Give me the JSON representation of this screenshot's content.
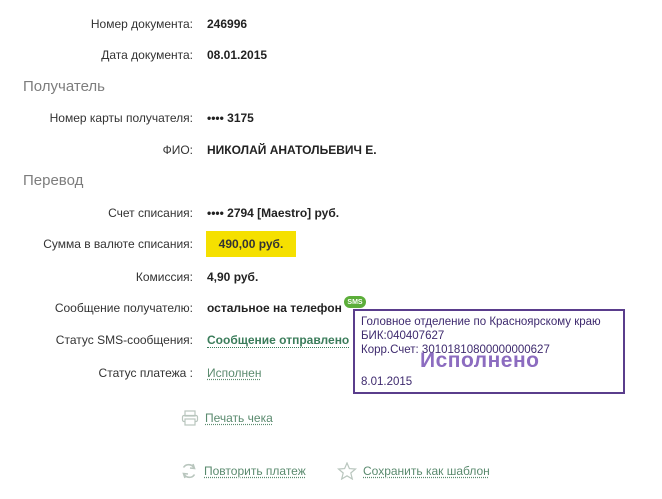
{
  "document": {
    "number_label": "Номер документа:",
    "number_value": "246996",
    "date_label": "Дата документа:",
    "date_value": "08.01.2015"
  },
  "recipient": {
    "section_title": "Получатель",
    "card_label": "Номер карты получателя:",
    "card_value": "•••• 3175",
    "name_label": "ФИО:",
    "name_value": "НИКОЛАЙ АНАТОЛЬЕВИЧ Е."
  },
  "transfer": {
    "section_title": "Перевод",
    "account_label": "Счет списания:",
    "account_value": "•••• 2794  [Maestro]  руб.",
    "amount_label": "Сумма в валюте списания:",
    "amount_value": "490,00   руб.",
    "fee_label": "Комиссия:",
    "fee_value": "4,90 руб.",
    "message_label": "Сообщение получателю:",
    "message_value": "остальное на телефон",
    "sms_badge": "SMS",
    "sms_status_label": "Статус SMS-сообщения:",
    "sms_status_value": "Сообщение отправлено",
    "payment_status_label": "Статус платежа :",
    "payment_status_value": "Исполнен"
  },
  "stamp": {
    "line1": "Головное отделение по Красноярскому краю",
    "line2": "БИК:040407627",
    "line3": "Корр.Счет: 30101810800000000627",
    "status": "Исполнено",
    "date": "8.01.2015"
  },
  "actions": {
    "print": "Печать чека",
    "repeat": "Повторить платеж",
    "save_template": "Сохранить как шаблон"
  },
  "colors": {
    "highlight": "#f5e000",
    "stamp_border": "#5a3d8c",
    "link": "#5a8a6e",
    "sms_badge": "#5cae3a"
  },
  "icons": [
    "sms-icon",
    "printer-icon",
    "repeat-icon",
    "star-icon"
  ]
}
